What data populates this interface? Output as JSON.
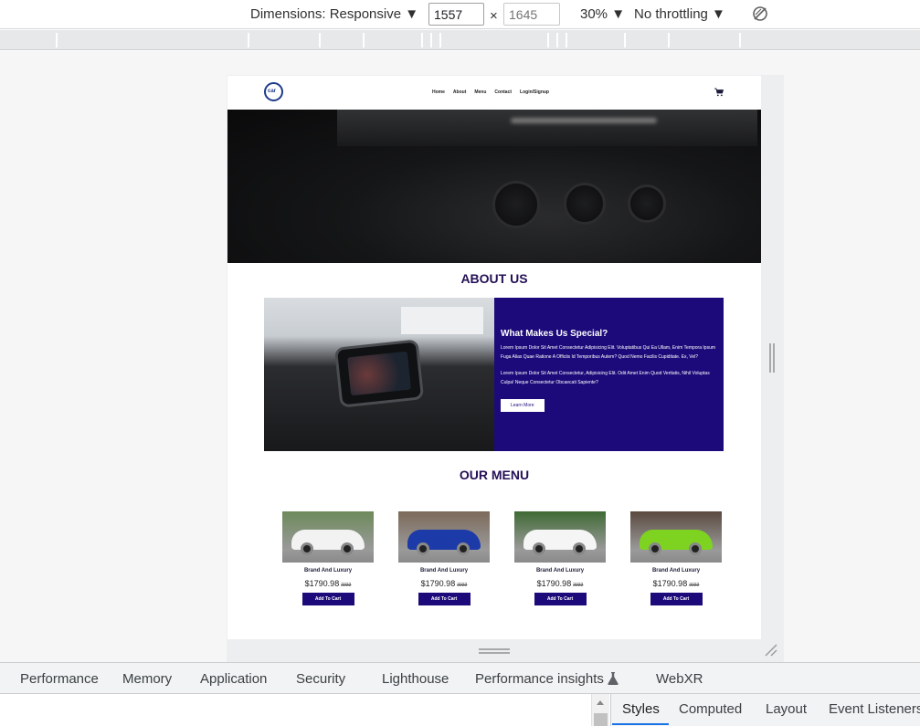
{
  "toolbar": {
    "dimensions_label": "Dimensions: Responsive ▼",
    "width_value": "1557",
    "times_sign": "×",
    "height_placeholder": "1645",
    "zoom_label": "30% ▼",
    "throttling_label": "No throttling ▼",
    "rotate_icon": "rotate-disabled-icon"
  },
  "site": {
    "logo_text": "car",
    "nav": [
      "Home",
      "About",
      "Menu",
      "Contact",
      "Login/Signup"
    ],
    "cart_icon": "cart-icon",
    "about_title": "ABOUT US",
    "about_heading": "What Makes Us Special?",
    "about_p1": "Lorem Ipsum Dolor Sit Amet Consectetur Adipisicing Elit. Voluptatibus Qui Ea Ullam, Enim Tempora Ipsum Fuga Alias Quae Ratione A Officiis Id Temporibus Autem? Quod Nemo Facilis Cupiditate. Ex, Vel?",
    "about_p2": "Lorem Ipsum Dolor Sit Amet Consectetur, Adipisicing Elit. Odit Amet Enim Quod Veritatis, Nihil Voluptas Culpa! Neque Consectetur Obcaecati Sapiente?",
    "learn_more": "Learn More",
    "menu_title": "OUR MENU",
    "products": [
      {
        "name": "Brand And Luxury",
        "price": "$1790.98",
        "old_price": "2222",
        "button": "Add To Cart",
        "car_color": "#f2f2f2",
        "bg": "#6d8a5a"
      },
      {
        "name": "Brand And Luxury",
        "price": "$1790.98",
        "old_price": "2222",
        "button": "Add To Cart",
        "car_color": "#1c3aa8",
        "bg": "#7d6a5a"
      },
      {
        "name": "Brand And Luxury",
        "price": "$1790.98",
        "old_price": "2222",
        "button": "Add To Cart",
        "car_color": "#f5f5f5",
        "bg": "#3f6a34"
      },
      {
        "name": "Brand And Luxury",
        "price": "$1790.98",
        "old_price": "2222",
        "button": "Add To Cart",
        "car_color": "#7ed321",
        "bg": "#5a4a40"
      }
    ]
  },
  "devtools": {
    "tabs": [
      "Performance",
      "Memory",
      "Application",
      "Security",
      "Lighthouse",
      "Performance insights",
      "WebXR"
    ],
    "subtabs": [
      "Styles",
      "Computed",
      "Layout",
      "Event Listeners"
    ],
    "active_subtab": "Styles",
    "accent": "#1a73e8"
  }
}
